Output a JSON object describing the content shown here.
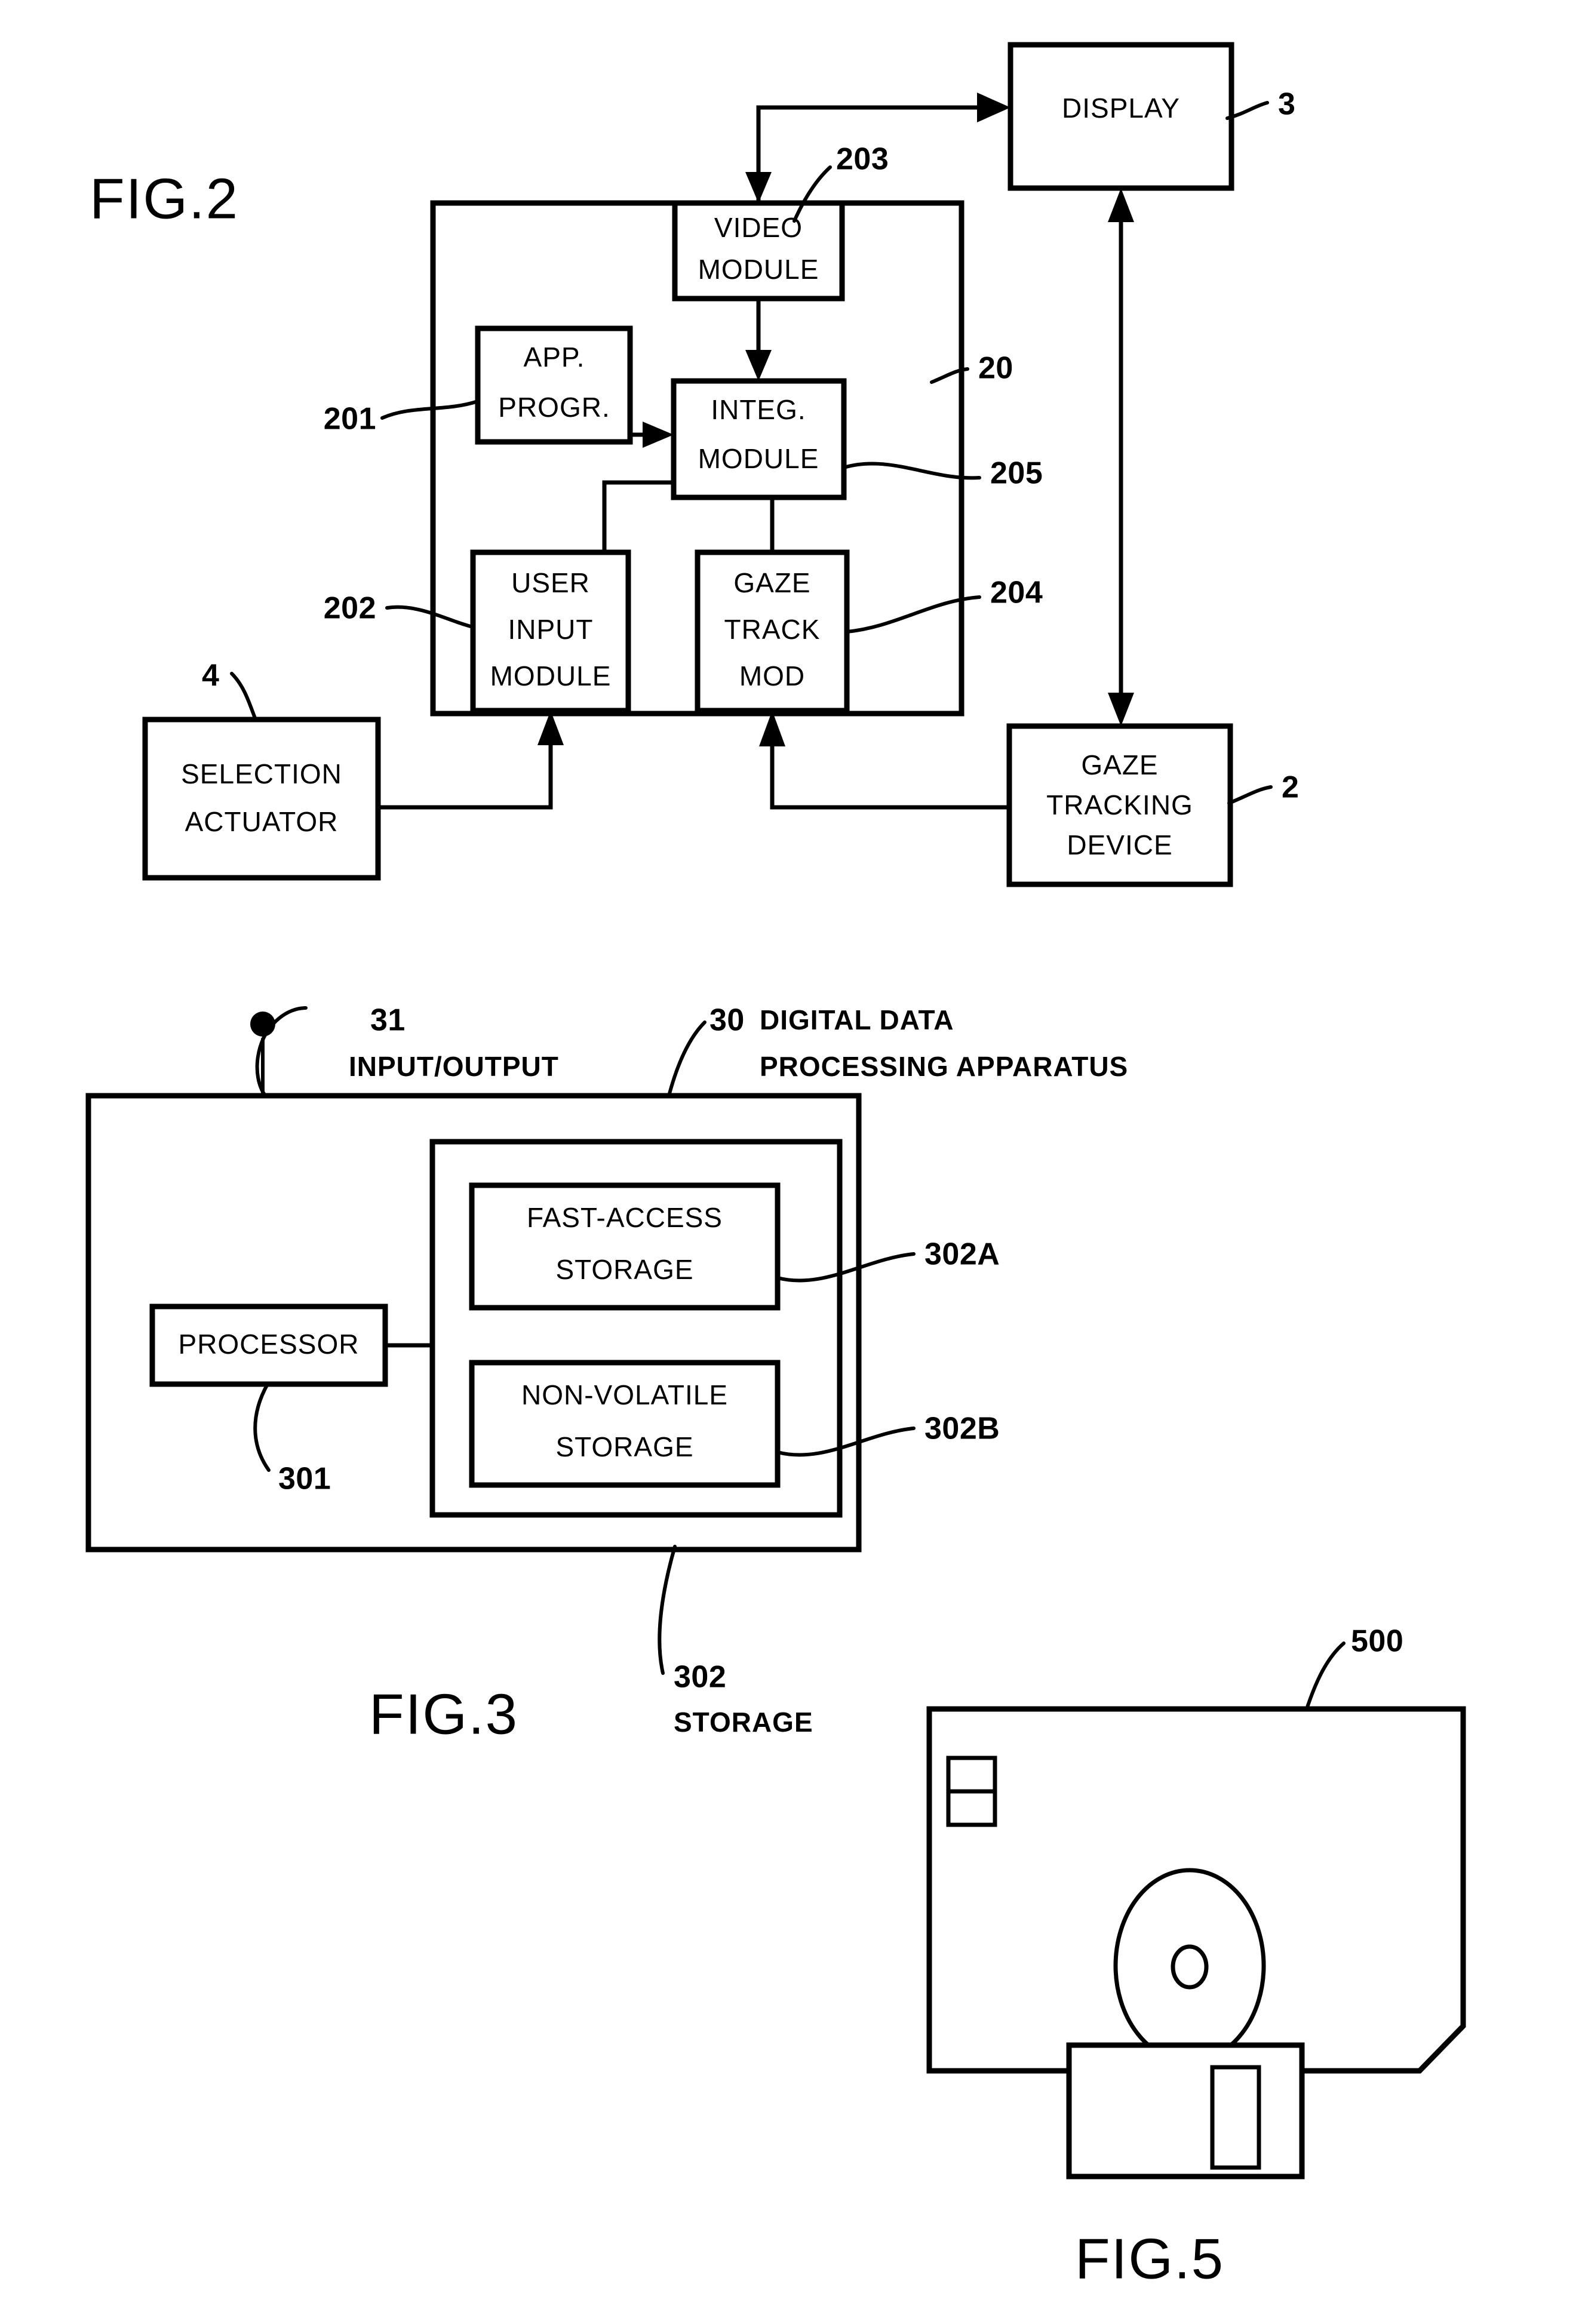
{
  "document": {
    "kind": "patent-drawing-sheet",
    "figures": [
      "FIG.2",
      "FIG.3",
      "FIG.5"
    ]
  },
  "fig2": {
    "label": "FIG.2",
    "boxes": {
      "display": "DISPLAY",
      "video_module_line1": "VIDEO",
      "video_module_line2": "MODULE",
      "app_progr_line1": "APP.",
      "app_progr_line2": "PROGR.",
      "integ_module_line1": "INTEG.",
      "integ_module_line2": "MODULE",
      "user_input_line1": "USER",
      "user_input_line2": "INPUT",
      "user_input_line3": "MODULE",
      "gaze_track_line1": "GAZE",
      "gaze_track_line2": "TRACK",
      "gaze_track_line3": "MOD",
      "selection_actuator_line1": "SELECTION",
      "selection_actuator_line2": "ACTUATOR",
      "gaze_device_line1": "GAZE",
      "gaze_device_line2": "TRACKING",
      "gaze_device_line3": "DEVICE"
    },
    "refs": {
      "display": "3",
      "video_module": "203",
      "app_progr": "201",
      "integ_module": "205",
      "user_input": "202",
      "gaze_track": "204",
      "enclosure": "20",
      "selection_actuator": "4",
      "gaze_device": "2"
    }
  },
  "fig3": {
    "label": "FIG.3",
    "boxes": {
      "processor": "PROCESSOR",
      "fast_access_line1": "FAST-ACCESS",
      "fast_access_line2": "STORAGE",
      "non_volatile_line1": "NON-VOLATILE",
      "non_volatile_line2": "STORAGE"
    },
    "refs": {
      "input_output_num": "31",
      "input_output_text": "INPUT/OUTPUT",
      "apparatus_num": "30",
      "apparatus_text_line1": "DIGITAL DATA",
      "apparatus_text_line2": "PROCESSING APPARATUS",
      "processor": "301",
      "fast_access": "302A",
      "non_volatile": "302B",
      "storage_num": "302",
      "storage_text": "STORAGE"
    }
  },
  "fig5": {
    "label": "FIG.5",
    "refs": {
      "diskette": "500"
    },
    "parts": {
      "write_protect_tab": "write-protect-tab",
      "hub": "hub",
      "hub_hole": "hub-hole",
      "shutter": "shutter",
      "shutter_window": "shutter-window"
    }
  },
  "colors": {
    "ink": "#000000",
    "paper": "#ffffff"
  }
}
